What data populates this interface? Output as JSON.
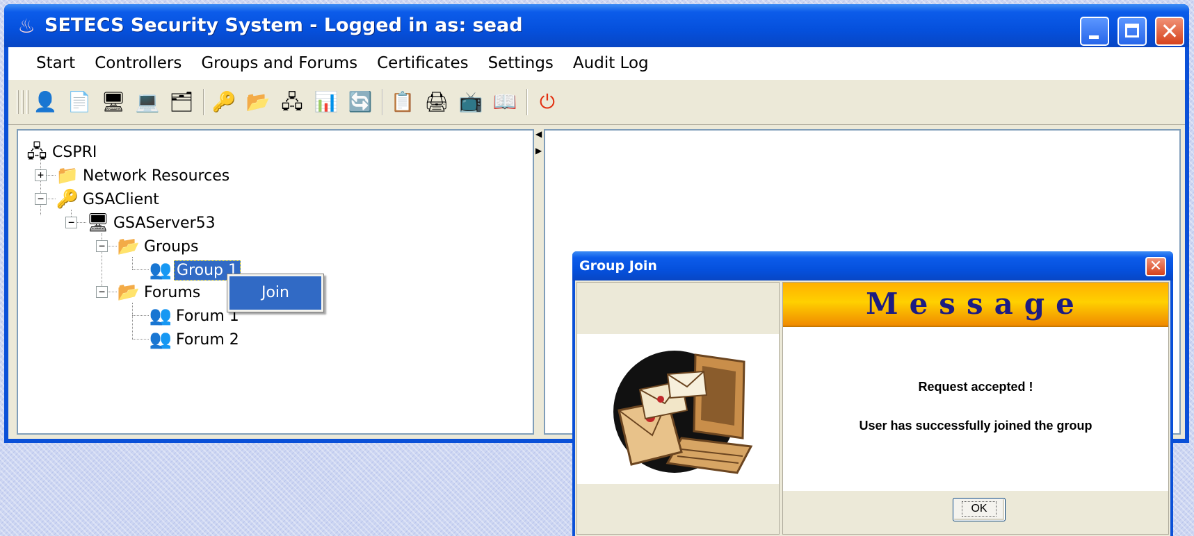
{
  "window": {
    "title": "SETECS Security System - Logged in as: sead",
    "icon": "app-logo-icon",
    "controls": {
      "minimize": "minimize",
      "maximize": "maximize",
      "close": "close"
    }
  },
  "menu": {
    "items": [
      "Start",
      "Controllers",
      "Groups and Forums",
      "Certificates",
      "Settings",
      "Audit Log"
    ]
  },
  "toolbar": {
    "buttons": [
      "user-admin-icon",
      "documents-icon",
      "monitor-red-icon",
      "monitor-send-icon",
      "key-card-icon",
      "user-key-icon",
      "folder-open-icon",
      "network-icon",
      "chart-window-icon",
      "refresh-icon",
      "properties-icon",
      "printer-icon",
      "display-settings-icon",
      "help-book-icon",
      "power-off-icon"
    ]
  },
  "tree": {
    "root": "CSPRI",
    "network_resources": "Network Resources",
    "client": "GSAClient",
    "server": "GSAServer53",
    "groups_folder": "Groups",
    "group_item": "Group 1",
    "forums_folder": "Forums",
    "forum_items": [
      "Forum 1",
      "Forum 2"
    ]
  },
  "context_menu": {
    "join": "Join"
  },
  "dialog": {
    "title": "Group Join",
    "heading": "Message",
    "line1": "Request accepted !",
    "line2": "User has successfully joined the group",
    "ok": "OK"
  }
}
